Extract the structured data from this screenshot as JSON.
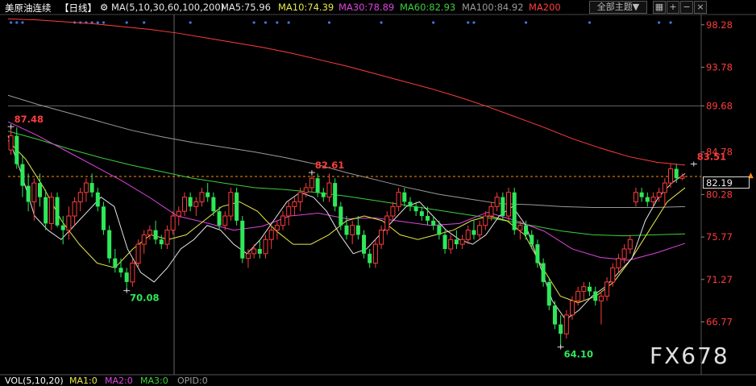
{
  "header": {
    "symbol": "美原油连续",
    "period": "【日线】",
    "ma_params": "MA(5,10,30,60,100,200)",
    "ma5": "MA5:75.96",
    "ma10": "MA10:74.39",
    "ma30": "MA30:78.89",
    "ma60": "MA60:82.93",
    "ma100": "MA100:84.92",
    "ma200": "MA200",
    "theme_label": "全部主题▼",
    "ctrl_icons": [
      "grid-icon",
      "plus-icon",
      "minus-icon",
      "close-icon"
    ]
  },
  "footer": {
    "vol": "VOL(5,10,20)",
    "ma1": "MA1:0",
    "ma2": "MA2:0",
    "ma3": "MA3:0",
    "opid": "OPID:0"
  },
  "watermark": "FX678",
  "last_price": "82.19",
  "colors": {
    "up": "#ff3c3c",
    "down": "#2ee85a",
    "ma5": "#e6e6e6",
    "ma10": "#e8e84a",
    "ma30": "#e044e0",
    "ma60": "#3ccf3c",
    "ma100": "#9a9a9a",
    "ma200": "#ff3c3c",
    "axis_text": "#ff3c3c"
  },
  "chart_data": {
    "type": "candlestick",
    "y_ticks": [
      "98.28",
      "93.78",
      "89.68",
      "84.78",
      "80.28",
      "75.77",
      "71.27",
      "66.77"
    ],
    "ylim": [
      63.3,
      99.2
    ],
    "candles": [
      [
        85.0,
        87.5,
        84.5,
        86.5
      ],
      [
        86.5,
        87.4,
        83.0,
        83.5
      ],
      [
        83.5,
        84.5,
        80.0,
        81.2
      ],
      [
        81.2,
        82.5,
        78.5,
        79.5
      ],
      [
        79.5,
        82.0,
        77.5,
        81.5
      ],
      [
        81.5,
        82.5,
        79.0,
        80.0
      ],
      [
        80.0,
        80.8,
        76.5,
        77.2
      ],
      [
        77.2,
        80.5,
        76.5,
        80.0
      ],
      [
        80.0,
        80.5,
        76.8,
        77.0
      ],
      [
        77.0,
        78.0,
        75.0,
        76.5
      ],
      [
        76.5,
        79.0,
        75.5,
        78.0
      ],
      [
        78.0,
        80.0,
        77.0,
        79.5
      ],
      [
        79.5,
        81.0,
        78.5,
        80.5
      ],
      [
        80.5,
        82.0,
        79.5,
        81.5
      ],
      [
        81.5,
        82.5,
        80.0,
        80.5
      ],
      [
        80.5,
        81.0,
        78.5,
        79.0
      ],
      [
        79.0,
        79.5,
        76.0,
        76.5
      ],
      [
        76.5,
        77.0,
        73.0,
        73.5
      ],
      [
        73.5,
        74.5,
        72.0,
        72.5
      ],
      [
        72.5,
        73.5,
        71.5,
        72.0
      ],
      [
        72.0,
        72.5,
        70.08,
        71.0
      ],
      [
        71.0,
        73.5,
        70.5,
        73.0
      ],
      [
        73.0,
        75.5,
        72.5,
        75.0
      ],
      [
        75.0,
        76.5,
        74.0,
        76.0
      ],
      [
        76.0,
        77.0,
        75.5,
        76.5
      ],
      [
        76.5,
        77.5,
        75.0,
        75.5
      ],
      [
        75.5,
        76.0,
        74.5,
        75.0
      ],
      [
        75.0,
        77.0,
        74.5,
        76.5
      ],
      [
        76.5,
        78.5,
        76.0,
        78.0
      ],
      [
        78.0,
        79.0,
        77.0,
        78.5
      ],
      [
        78.5,
        80.5,
        78.0,
        80.0
      ],
      [
        80.0,
        80.5,
        78.5,
        79.0
      ],
      [
        79.0,
        80.0,
        78.0,
        79.5
      ],
      [
        79.5,
        81.0,
        79.0,
        80.5
      ],
      [
        80.5,
        81.5,
        79.5,
        80.0
      ],
      [
        80.0,
        80.5,
        78.0,
        78.5
      ],
      [
        78.5,
        79.0,
        76.5,
        77.0
      ],
      [
        77.0,
        78.5,
        76.5,
        78.0
      ],
      [
        78.0,
        81.0,
        77.5,
        80.5
      ],
      [
        80.5,
        81.0,
        77.0,
        77.5
      ],
      [
        77.5,
        78.0,
        73.0,
        73.5
      ],
      [
        73.5,
        74.5,
        72.5,
        74.0
      ],
      [
        74.0,
        75.0,
        73.5,
        74.5
      ],
      [
        74.5,
        75.5,
        73.5,
        74.0
      ],
      [
        74.0,
        76.0,
        73.5,
        75.5
      ],
      [
        75.5,
        77.0,
        74.5,
        76.5
      ],
      [
        76.5,
        77.5,
        75.5,
        77.0
      ],
      [
        77.0,
        78.5,
        76.5,
        78.0
      ],
      [
        78.0,
        79.5,
        77.0,
        79.0
      ],
      [
        79.0,
        80.0,
        78.0,
        79.5
      ],
      [
        79.5,
        81.0,
        78.5,
        80.5
      ],
      [
        80.5,
        81.5,
        80.0,
        81.0
      ],
      [
        81.0,
        82.61,
        80.5,
        82.0
      ],
      [
        82.0,
        82.5,
        80.0,
        80.5
      ],
      [
        80.5,
        81.0,
        79.5,
        80.0
      ],
      [
        80.0,
        82.5,
        79.5,
        81.5
      ],
      [
        81.5,
        82.0,
        78.5,
        79.0
      ],
      [
        79.0,
        79.5,
        76.5,
        77.0
      ],
      [
        77.0,
        78.0,
        75.5,
        76.0
      ],
      [
        76.0,
        77.5,
        75.0,
        77.0
      ],
      [
        77.0,
        78.0,
        75.5,
        76.0
      ],
      [
        76.0,
        76.5,
        73.5,
        74.0
      ],
      [
        74.0,
        74.5,
        72.5,
        73.0
      ],
      [
        73.0,
        75.5,
        72.5,
        75.0
      ],
      [
        75.0,
        77.0,
        74.5,
        76.5
      ],
      [
        76.5,
        78.5,
        76.0,
        78.0
      ],
      [
        78.0,
        79.5,
        77.5,
        79.0
      ],
      [
        79.0,
        81.0,
        78.5,
        80.5
      ],
      [
        80.5,
        81.0,
        79.0,
        79.5
      ],
      [
        79.5,
        80.0,
        78.5,
        79.0
      ],
      [
        79.0,
        79.5,
        78.0,
        78.5
      ],
      [
        78.5,
        79.0,
        77.5,
        78.0
      ],
      [
        78.0,
        79.0,
        77.0,
        77.5
      ],
      [
        77.5,
        78.0,
        76.5,
        77.0
      ],
      [
        77.0,
        77.5,
        75.5,
        76.0
      ],
      [
        76.0,
        76.5,
        74.0,
        74.5
      ],
      [
        74.5,
        76.0,
        74.0,
        75.5
      ],
      [
        75.5,
        76.5,
        74.5,
        75.0
      ],
      [
        75.0,
        76.0,
        74.5,
        75.5
      ],
      [
        75.5,
        77.0,
        75.0,
        76.5
      ],
      [
        76.5,
        77.5,
        75.5,
        76.0
      ],
      [
        76.0,
        77.5,
        75.5,
        77.0
      ],
      [
        77.0,
        78.5,
        76.5,
        78.0
      ],
      [
        78.0,
        79.5,
        77.5,
        79.0
      ],
      [
        79.0,
        80.5,
        78.5,
        80.0
      ],
      [
        80.0,
        80.5,
        77.5,
        78.0
      ],
      [
        78.0,
        81.0,
        77.5,
        80.5
      ],
      [
        80.5,
        81.0,
        76.0,
        76.5
      ],
      [
        76.5,
        77.5,
        75.5,
        77.0
      ],
      [
        77.0,
        77.5,
        75.5,
        76.0
      ],
      [
        76.0,
        76.5,
        74.5,
        75.0
      ],
      [
        75.0,
        75.5,
        72.5,
        73.0
      ],
      [
        73.0,
        73.5,
        70.5,
        71.0
      ],
      [
        71.0,
        71.5,
        68.0,
        68.5
      ],
      [
        68.5,
        69.0,
        66.0,
        66.5
      ],
      [
        66.5,
        67.5,
        64.1,
        65.5
      ],
      [
        65.5,
        68.0,
        65.0,
        67.5
      ],
      [
        67.5,
        69.5,
        67.0,
        69.0
      ],
      [
        69.0,
        70.5,
        68.5,
        70.0
      ],
      [
        70.0,
        71.0,
        69.0,
        70.5
      ],
      [
        70.5,
        71.0,
        69.5,
        70.0
      ],
      [
        70.0,
        70.5,
        68.5,
        69.0
      ],
      [
        69.0,
        70.0,
        66.5,
        69.5
      ],
      [
        69.5,
        71.5,
        69.0,
        71.0
      ],
      [
        71.0,
        73.0,
        70.5,
        72.5
      ],
      [
        72.5,
        74.0,
        72.0,
        73.5
      ],
      [
        73.5,
        75.0,
        73.0,
        74.5
      ],
      [
        74.5,
        76.0,
        74.0,
        75.5
      ],
      [
        79.5,
        81.0,
        79.0,
        80.5
      ],
      [
        80.5,
        81.0,
        79.5,
        80.0
      ],
      [
        80.0,
        80.5,
        79.0,
        79.5
      ],
      [
        79.5,
        80.5,
        79.0,
        80.0
      ],
      [
        80.0,
        81.0,
        79.5,
        80.5
      ],
      [
        80.5,
        82.0,
        79.0,
        81.5
      ],
      [
        81.5,
        83.51,
        81.0,
        83.0
      ],
      [
        83.0,
        83.5,
        81.5,
        82.0
      ],
      [
        82.0,
        82.5,
        81.8,
        82.19
      ]
    ],
    "annotations": [
      {
        "label": "87.48",
        "idx": 0,
        "value": 87.48,
        "kind": "high"
      },
      {
        "label": "70.08",
        "idx": 20,
        "value": 70.08,
        "kind": "low"
      },
      {
        "label": "82.61",
        "idx": 52,
        "value": 82.61,
        "kind": "high"
      },
      {
        "label": "64.10",
        "idx": 95,
        "value": 64.1,
        "kind": "low"
      },
      {
        "label": "83.51",
        "idx": 118,
        "value": 83.51,
        "kind": "high"
      }
    ],
    "ma200_line": [
      98.9,
      98.8,
      98.6,
      98.4,
      98.1,
      97.8,
      97.4,
      96.9,
      96.4,
      95.9,
      95.3,
      94.6,
      93.9,
      93.1,
      92.3,
      91.5,
      90.6,
      89.6,
      88.5,
      87.4,
      86.2,
      85.2,
      84.3,
      83.7,
      83.4
    ],
    "ma100_line": [
      90.8,
      89.8,
      88.9,
      88.0,
      87.1,
      86.4,
      85.8,
      85.3,
      84.8,
      84.2,
      83.5,
      82.6,
      81.8,
      81.0,
      80.3,
      79.8,
      79.3,
      79.2,
      79.0,
      78.9,
      78.9,
      78.9,
      79.0
    ],
    "ma60_line": [
      87.0,
      86.1,
      85.1,
      84.2,
      83.4,
      82.7,
      82.0,
      81.5,
      81.0,
      80.8,
      80.5,
      80.1,
      79.6,
      79.1,
      78.6,
      78.1,
      77.6,
      77.0,
      76.4,
      76.0,
      75.9,
      76.0,
      76.1
    ],
    "ma30_line": [
      88.0,
      86.6,
      85.0,
      83.4,
      81.8,
      80.0,
      78.0,
      77.3,
      76.5,
      76.9,
      78.0,
      78.3,
      77.7,
      77.8,
      77.4,
      77.0,
      77.2,
      78.4,
      77.5,
      76.4,
      74.5,
      73.6,
      73.3,
      74.1,
      75.1
    ],
    "ma10_line": [
      86.0,
      84.0,
      81.0,
      77.5,
      75.0,
      73.0,
      72.5,
      74.5,
      76.0,
      75.5,
      76.0,
      77.5,
      79.0,
      79.5,
      78.5,
      76.5,
      75.0,
      75.0,
      76.0,
      77.5,
      78.0,
      77.5,
      76.0,
      75.5,
      76.0,
      76.5,
      77.5,
      78.0,
      77.5,
      76.0,
      72.5,
      69.5,
      68.8,
      69.5,
      71.0,
      73.5,
      76.5,
      79.5,
      81.0
    ],
    "ma5_line": [
      86.5,
      82.5,
      78.0,
      76.5,
      75.5,
      77.0,
      78.5,
      80.0,
      79.0,
      74.5,
      72.0,
      71.0,
      72.5,
      74.5,
      75.5,
      77.0,
      76.5,
      75.0,
      74.0,
      75.5,
      77.5,
      79.5,
      80.5,
      80.0,
      78.5,
      76.0,
      74.0,
      74.5,
      76.0,
      77.5,
      79.0,
      79.5,
      78.0,
      76.5,
      75.5,
      75.0,
      76.0,
      78.0,
      79.0,
      77.0,
      73.0,
      69.0,
      67.0,
      68.0,
      69.5,
      70.5,
      72.0,
      73.5,
      77.5,
      80.0,
      81.5,
      82.5
    ]
  }
}
